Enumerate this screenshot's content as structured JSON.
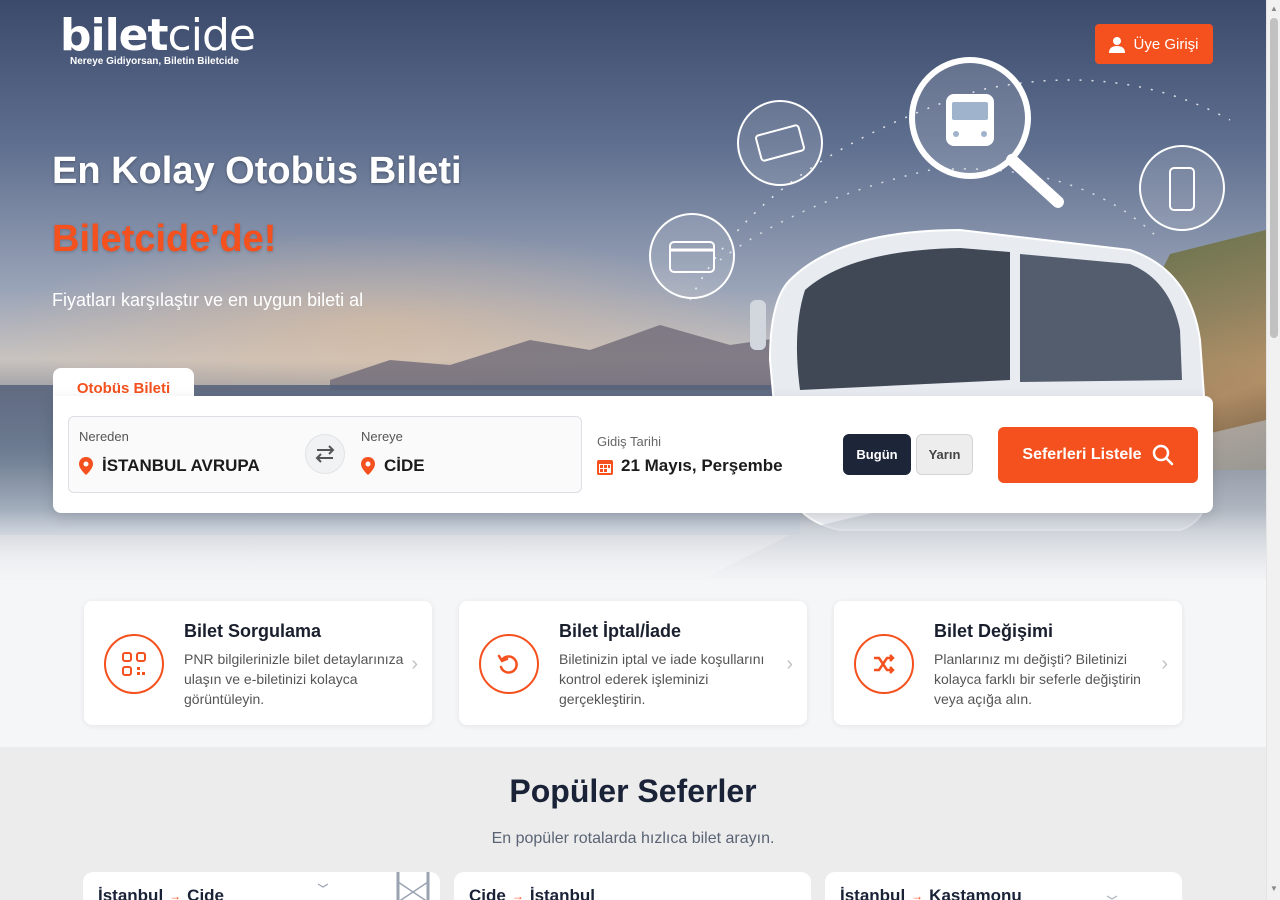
{
  "header": {
    "logo_light": "bilet",
    "logo_bold": "cide",
    "logo_tagline": "Nereye Gidiyorsan, Biletin Biletcide",
    "login_label": "Üye Girişi"
  },
  "hero": {
    "title": "En Kolay Otobüs Bileti",
    "accent": "Biletcide'de!",
    "subtitle": "Fiyatları karşılaştır ve en uygun bileti al"
  },
  "search": {
    "tab_label": "Otobüs Bileti",
    "from_label": "Nereden",
    "from_value": "İSTANBUL AVRUPA",
    "to_label": "Nereye",
    "to_value": "CİDE",
    "date_label": "Gidiş Tarihi",
    "date_value": "21 Mayıs, Perşembe",
    "today_label": "Bugün",
    "tomorrow_label": "Yarın",
    "submit_label": "Seferleri Listele"
  },
  "services": [
    {
      "title": "Bilet Sorgulama",
      "desc": "PNR bilgilerinizle bilet detaylarınıza ulaşın ve e-biletinizi kolayca görüntüleyin.",
      "icon": "qr-code-icon"
    },
    {
      "title": "Bilet İptal/İade",
      "desc": "Biletinizin iptal ve iade koşullarını kontrol ederek işleminizi gerçekleştirin.",
      "icon": "undo-icon"
    },
    {
      "title": "Bilet Değişimi",
      "desc": "Planlarınız mı değişti? Biletinizi kolayca farklı bir seferle değiştirin veya açığa alın.",
      "icon": "shuffle-icon"
    }
  ],
  "popular": {
    "title": "Popüler Seferler",
    "subtitle": "En popüler rotalarda hızlıca bilet arayın.",
    "routes": [
      {
        "from": "İstanbul",
        "to": "Cide"
      },
      {
        "from": "Cide",
        "to": "İstanbul"
      },
      {
        "from": "İstanbul",
        "to": "Kastamonu"
      }
    ]
  },
  "colors": {
    "brand": "#f4511e",
    "dark": "#1d2539"
  }
}
